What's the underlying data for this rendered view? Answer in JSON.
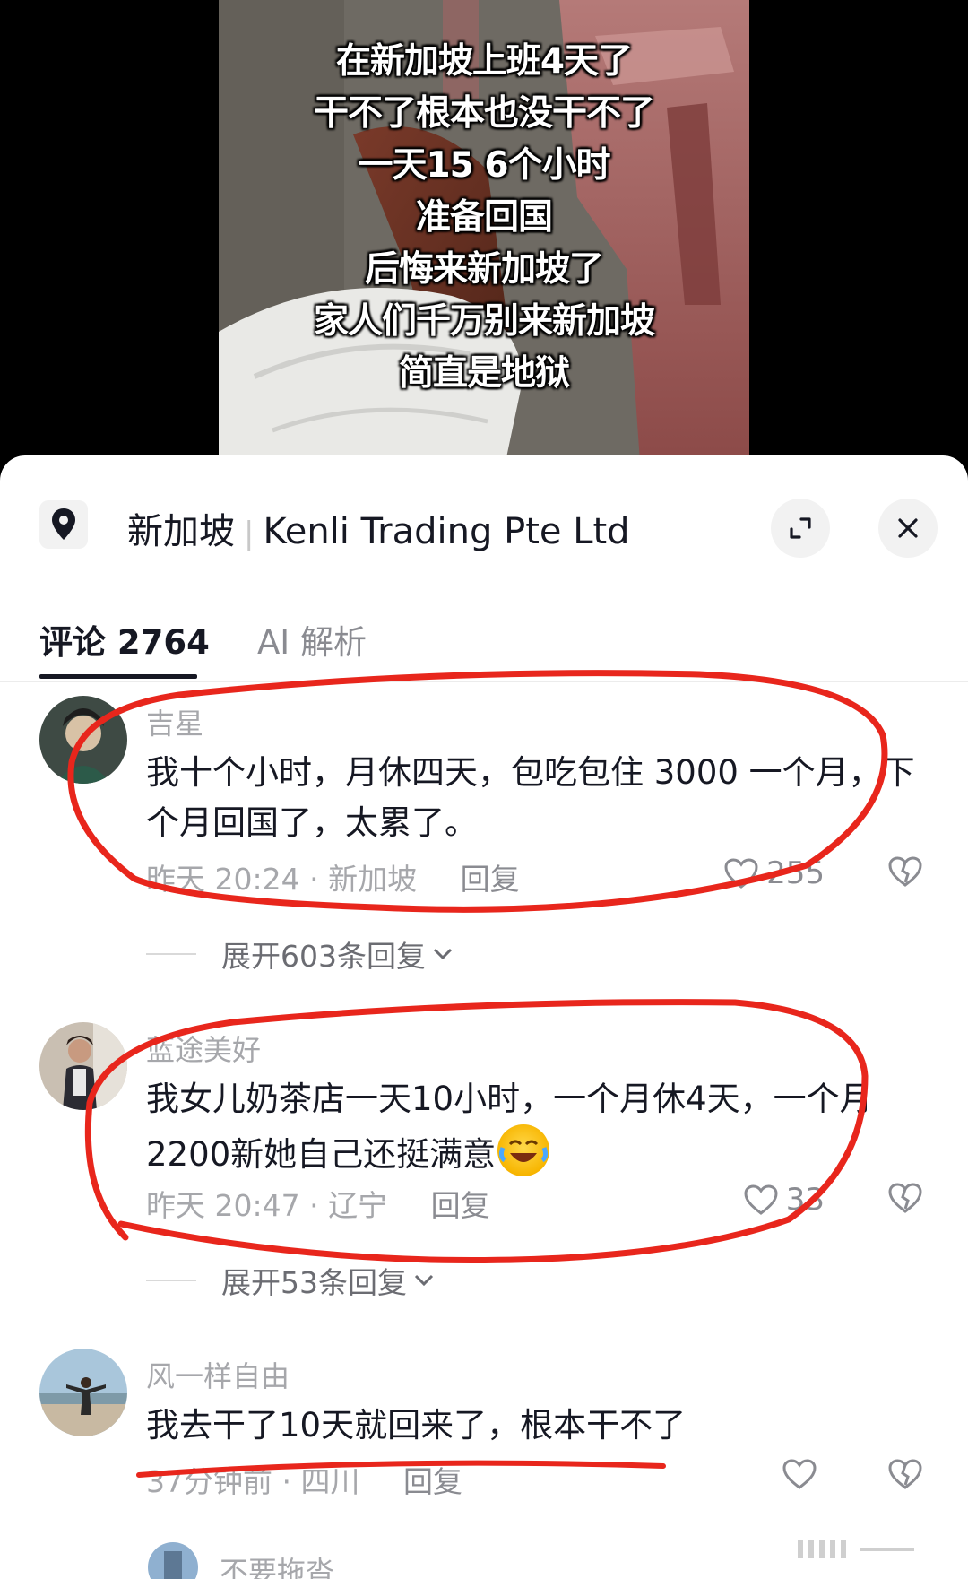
{
  "video": {
    "captions": [
      "在新加坡上班4天了",
      "干不了根本也没干不了",
      "一天15 6个小时",
      "准备回国",
      "后悔来新加坡了",
      "家人们千万别来新加坡",
      "简直是地狱"
    ]
  },
  "location_bar": {
    "pin_icon": "location-pin-icon",
    "city": "新加坡",
    "separator": "|",
    "place": "Kenli Trading Pte Ltd",
    "expand_icon": "expand-icon",
    "close_icon": "close-icon"
  },
  "tabs": [
    {
      "label": "评论 2764",
      "active": true
    },
    {
      "label": "AI 解析",
      "active": false
    }
  ],
  "comments": [
    {
      "username": "吉星",
      "text": "我十个小时，月休四天，包吃包住 3000 一个月，下个月回国了，太累了。",
      "time": "昨天 20:24",
      "location": "新加坡",
      "reply_label": "回复",
      "likes": "255",
      "expand_label": "展开603条回复"
    },
    {
      "username": "蓝途美好",
      "text": "我女儿奶茶店一天10小时，一个月休4天，一个月2200新她自己还挺满意",
      "emoji": "crying-laughing-emoji",
      "time": "昨天 20:47",
      "location": "辽宁",
      "reply_label": "回复",
      "likes": "33",
      "expand_label": "展开53条回复"
    },
    {
      "username": "风一样自由",
      "text": "我去干了10天就回来了，根本干不了",
      "time": "37分钟前",
      "location": "四川",
      "reply_label": "回复",
      "likes": ""
    },
    {
      "username": "不要拖沓"
    }
  ],
  "colors": {
    "annotation_red": "#e8261c",
    "text_primary": "#161823",
    "text_secondary": "#a6a7ab"
  }
}
